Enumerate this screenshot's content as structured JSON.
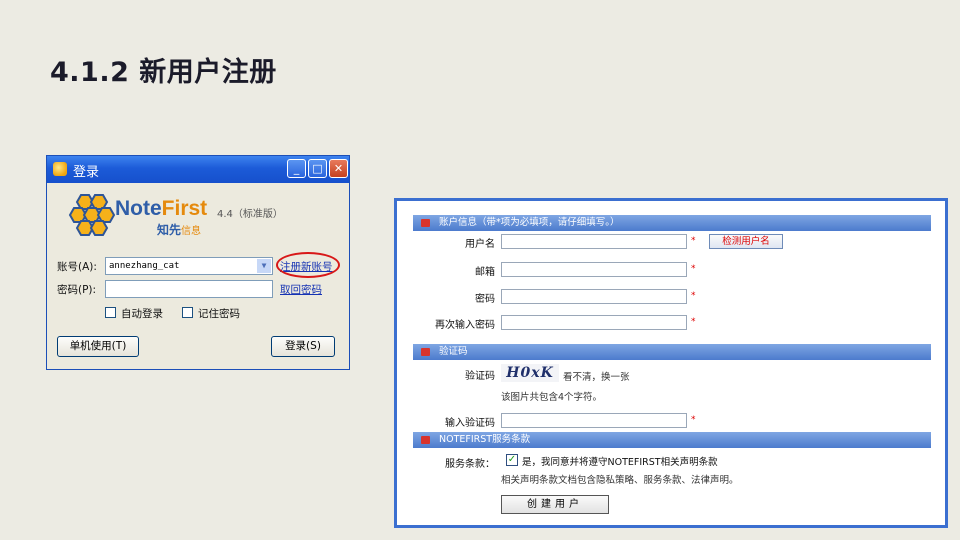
{
  "slide": {
    "title": "4.1.2  新用户注册"
  },
  "login": {
    "window_title": "登录",
    "logo_text_a": "Note",
    "logo_text_b": "First",
    "version": "4.4（标准版）",
    "cn_name_a": "知先",
    "cn_name_b": "信息",
    "account_label": "账号(A):",
    "account_value": "annezhang_cat",
    "password_label": "密码(P):",
    "register_link": "注册新账号",
    "recover_link": "取回密码",
    "auto_login": "自动登录",
    "remember_password": "记住密码",
    "offline_button": "单机使用(T)",
    "login_button": "登录(S)"
  },
  "register": {
    "account_section": "账户信息（带*项为必填项，请仔细填写。）",
    "username_label": "用户名",
    "check_username_button": "检测用户名",
    "email_label": "邮箱",
    "password_label": "密码",
    "confirm_label": "再次输入密码",
    "captcha_section": "验证码",
    "captcha_label": "验证码",
    "captcha_text": "H0xK",
    "captcha_refresh": "看不清，换一张",
    "captcha_note": "该图片共包含4个字符。",
    "enter_captcha_label": "输入验证码",
    "terms_section": "NOTEFIRST服务条款",
    "terms_label": "服务条款：",
    "terms_agree": "是，我同意并将遵守NOTEFIRST相关声明条款",
    "terms_note": "相关声明条款文档包含隐私策略、服务条款、法律声明。",
    "create_button": "创建用户",
    "required_mark": "*"
  }
}
